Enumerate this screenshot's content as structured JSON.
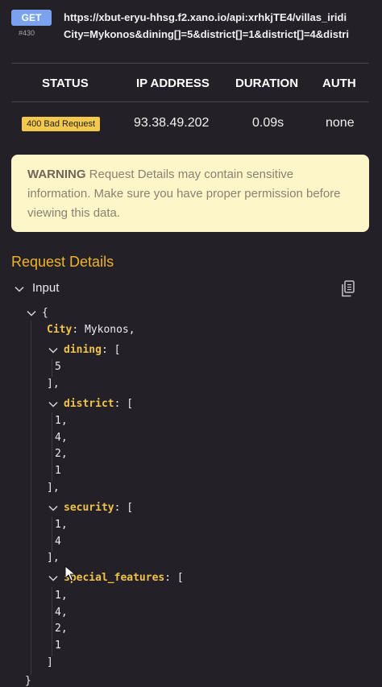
{
  "request": {
    "method": "GET",
    "id": "#430",
    "url_line1": "https://xbut-eryu-hhsg.f2.xano.io/api:xrhkjTE4/villas_iridi",
    "url_line2": "City=Mykonos&dining[]=5&district[]=1&district[]=4&distri"
  },
  "table": {
    "headers": [
      "STATUS",
      "IP ADDRESS",
      "DURATION",
      "AUTH"
    ],
    "status": "400 Bad Request",
    "ip_address": "93.38.49.202",
    "duration": "0.09s",
    "auth": "none",
    "status_color": "#f2c94c"
  },
  "warning": {
    "label": "WARNING",
    "text": "Request Details may contain sensitive information. Make sure you have proper permission before viewing this data."
  },
  "request_details": {
    "title": "Request Details",
    "input_label": "Input",
    "json": {
      "open_brace": "{",
      "close_brace": "}",
      "city_key": "City",
      "city_value": "Mykonos,",
      "dining_key": "dining",
      "dining_values": [
        "5"
      ],
      "district_key": "district",
      "district_values": [
        "1,",
        "4,",
        "2,",
        "1"
      ],
      "security_key": "security",
      "security_values": [
        "1,",
        "4"
      ],
      "special_key": "special_features",
      "special_values": [
        "1,",
        "4,",
        "2,",
        "1"
      ],
      "array_open": "[",
      "array_close_comma": "],",
      "array_close": "]"
    }
  },
  "icons": [
    "chevron-down-icon",
    "copy-icon",
    "mouse-cursor-icon"
  ],
  "colors": {
    "background": "#242027",
    "accent": "#f0b429",
    "key": "#f0c34c",
    "method_bg": "#7aa2ee",
    "warning_bg": "#fdf6c9"
  }
}
